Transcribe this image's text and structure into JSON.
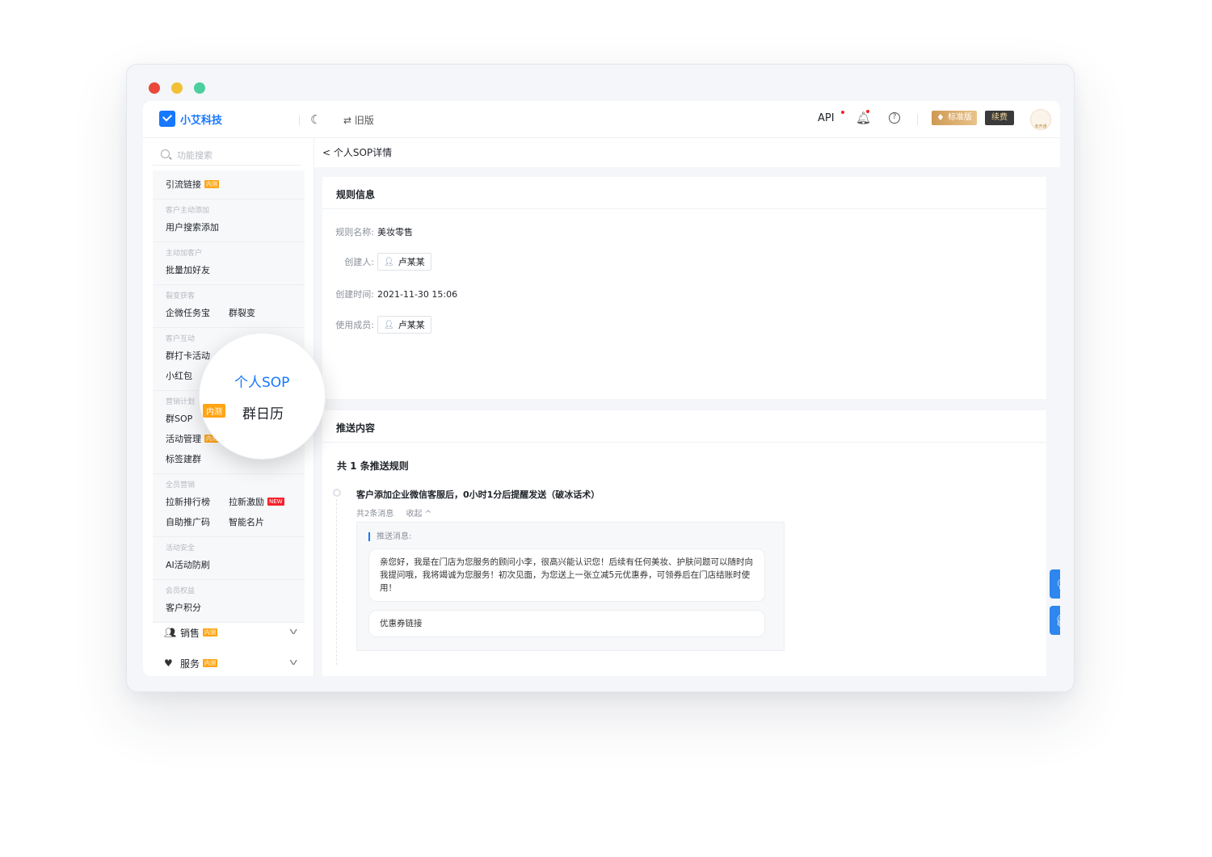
{
  "app": {
    "logo_text": "小艾科技",
    "old_version": "⇄ 旧版"
  },
  "topbar": {
    "api": "API",
    "plan_badge": "标准版",
    "renew": "续费",
    "avatar_caption": "未开通"
  },
  "sidebar": {
    "search_placeholder": "功能搜索",
    "groups": [
      {
        "title": "",
        "items": [
          {
            "label": "引流链接",
            "tag": "内测"
          }
        ]
      },
      {
        "title": "客户主动添加",
        "items": [
          {
            "label": "用户搜索添加"
          }
        ]
      },
      {
        "title": "主动加客户",
        "items": [
          {
            "label": "批量加好友"
          }
        ]
      },
      {
        "title": "裂变获客",
        "items": [
          {
            "label": "企微任务宝"
          },
          {
            "label": "群裂变"
          }
        ]
      },
      {
        "title": "客户互动",
        "items": [
          {
            "label": "群打卡活动"
          },
          {
            "label": "小红包"
          }
        ]
      },
      {
        "title": "营销计划",
        "items": [
          {
            "label": "群SOP"
          },
          {
            "label": "活动管理",
            "tag": "内测"
          },
          {
            "label": "标签建群"
          }
        ]
      },
      {
        "title": "全员营销",
        "items": [
          {
            "label": "拉新排行榜"
          },
          {
            "label": "拉新激励",
            "tag": "NEW"
          },
          {
            "label": "自助推广码"
          },
          {
            "label": "智能名片"
          }
        ]
      },
      {
        "title": "活动安全",
        "items": [
          {
            "label": "AI活动防刷"
          }
        ]
      },
      {
        "title": "会员权益",
        "items": [
          {
            "label": "客户积分"
          }
        ]
      }
    ],
    "sections": [
      {
        "label": "销售",
        "tag": "内测"
      },
      {
        "label": "服务",
        "tag": "内测"
      }
    ]
  },
  "magnifier": {
    "item1": "个人SOP",
    "item2": "群日历",
    "tag": "内测"
  },
  "main": {
    "breadcrumb": "< 个人SOP详情",
    "rule_info": {
      "title": "规则信息",
      "name_label": "规则名称:",
      "name_value": "美妆零售",
      "creator_label": "创建人:",
      "creator_value": "卢某某",
      "created_label": "创建时间:",
      "created_value": "2021-11-30 15:06",
      "members_label": "使用成员:",
      "members_value": "卢某某"
    },
    "push": {
      "title": "推送内容",
      "count_text": "共 1 条推送规则",
      "rule_title": "客户添加企业微信客服后，0小时1分后提醒发送（破冰话术）",
      "msg_count": "共2条消息",
      "collapse": "收起 ^",
      "msg_label": "推送消息:",
      "message1": "亲您好，我是在门店为您服务的顾问小李，很高兴能认识您！后续有任何美妆、护肤问题可以随时向我提问哦，我将竭诚为您服务！初次见面，为您送上一张立减5元优惠券，可领券后在门店结账时使用！",
      "message2": "优惠券链接"
    }
  },
  "colors": {
    "accent": "#1677ff",
    "tag": "#ffa516",
    "new_tag": "#f5222d"
  },
  "icons": [
    "moon-icon",
    "bell-icon",
    "help-icon",
    "search-icon",
    "user-icon",
    "chat-icon",
    "headset-icon"
  ]
}
